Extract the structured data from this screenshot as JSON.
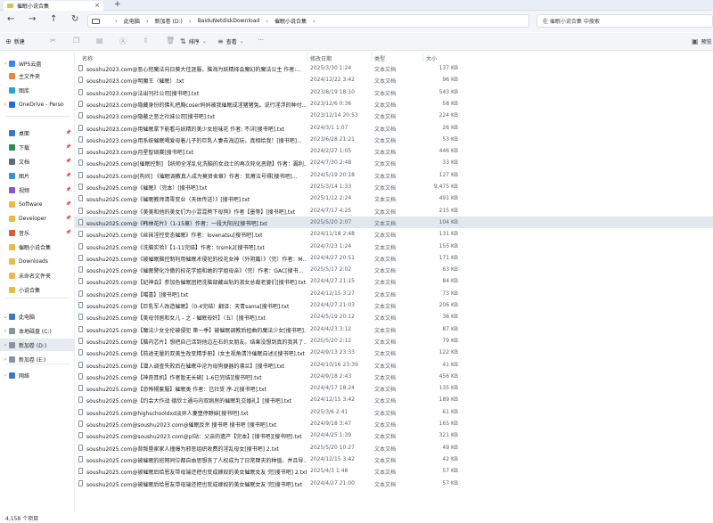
{
  "window": {
    "tab_title": "催眠小说合集",
    "tab_close": "×",
    "tab_add": "+"
  },
  "nav": {
    "back_icon": "←",
    "forward_icon": "→",
    "up_icon": "↑",
    "refresh_icon": "↻",
    "breadcrumbs": [
      "此电脑",
      "新加卷 (D:)",
      "BaiduNetdiskDownload",
      "催眠小说合集"
    ],
    "search_placeholder": "在 催眠小说合集 中搜索"
  },
  "toolbar": {
    "new_label": "新建",
    "sort_label": "排序",
    "view_label": "查看",
    "more_label": "···",
    "preview_label": "预览"
  },
  "sidebar": {
    "items": [
      {
        "label": "WPS云盘",
        "chev": "›",
        "color": "#3b82f6"
      },
      {
        "label": "主文件夹",
        "chev": "",
        "color": "#e08b3a"
      },
      {
        "label": "图库",
        "chev": "",
        "color": "#2aa0d8"
      },
      {
        "label": "OneDrive - Perso",
        "chev": "›",
        "color": "#1e6fd9"
      },
      {
        "label": "桌面",
        "chev": "",
        "color": "#3a78c8",
        "pin": true
      },
      {
        "label": "下载",
        "chev": "",
        "color": "#2b8a4e",
        "pin": true
      },
      {
        "label": "文档",
        "chev": "",
        "color": "#5b6b7e",
        "pin": true
      },
      {
        "label": "图片",
        "chev": "",
        "color": "#3a8fd8",
        "pin": true
      },
      {
        "label": "视频",
        "chev": "",
        "color": "#8b54c9",
        "pin": true
      },
      {
        "label": "Software",
        "chev": "",
        "color": "#e9b949",
        "pin": true
      },
      {
        "label": "Developer",
        "chev": "",
        "color": "#e9b949",
        "pin": true
      },
      {
        "label": "音乐",
        "chev": "",
        "color": "#e05a3a",
        "pin": true
      },
      {
        "label": "催眠小说合集",
        "chev": "",
        "color": "#e9b949"
      },
      {
        "label": "Downloads",
        "chev": "",
        "color": "#e9b949"
      },
      {
        "label": "未命名文件夹",
        "chev": "",
        "color": "#e9b949"
      },
      {
        "label": "小说合集",
        "chev": "",
        "color": "#e9b949"
      },
      {
        "label": "此电脑",
        "chev": "⌄",
        "color": "#3a78c8"
      },
      {
        "label": "本地磁盘 (C:)",
        "chev": "›",
        "color": "#8a93a0"
      },
      {
        "label": "新加卷 (D:)",
        "chev": "›",
        "color": "#8a93a0",
        "selected": true
      },
      {
        "label": "新加卷 (E:)",
        "chev": "›",
        "color": "#8a93a0"
      },
      {
        "label": "网络",
        "chev": "›",
        "color": "#3a78c8"
      }
    ]
  },
  "list": {
    "columns": {
      "name": "名称",
      "date": "修改日期",
      "type": "类型",
      "size": "大小"
    },
    "rows": [
      {
        "name": "soushu2023.com@恶心挖魔法向日葵大佳涯服，脑海为妖精择会魔幻的魔法公主 作者:...",
        "date": "2025/3/30 1:24",
        "type": "文本文档",
        "size": "137 KB"
      },
      {
        "name": "soushu2023.com@明魔王（催眠）.txt",
        "date": "2024/12/22 3:42",
        "type": "文本文档",
        "size": "96 KB"
      },
      {
        "name": "soushu2023.com@法出刊社公司[搜书吧].txt",
        "date": "2023/8/19 18:10",
        "type": "文本文档",
        "size": "543 KB"
      },
      {
        "name": "soushu2023.com@隐藏身份的佛礼把胸coser妈妈被我催眠成淫猪猪兔。说行淫浮的种付...",
        "date": "2023/12/6 0:36",
        "type": "文本文档",
        "size": "58 KB"
      },
      {
        "name": "soushu2023.com@隐蔽之恶之社妹公司[搜书吧].txt",
        "date": "2023/12/14 20:53",
        "type": "文本文档",
        "size": "224 KB"
      },
      {
        "name": "soushu2023.com@用催眠拿下能看与妖精的美少女班味花 作者: 不详[搜书吧].txt",
        "date": "2024/3/1 1:07",
        "type": "文本文档",
        "size": "26 KB"
      },
      {
        "name": "soushu2023.com@用系统催眠喝爱母着儿子的巨乳人妻去海边玩，真相给我！[搜书吧]...",
        "date": "2023/6/28 21:21",
        "type": "文本文档",
        "size": "53 KB"
      },
      {
        "name": "soushu2023.com@月星智硕赛[搜书吧].txt",
        "date": "2024/2/27 1:05",
        "type": "文本文档",
        "size": "446 KB"
      },
      {
        "name": "soushu2025.com@[催眠控制] 【统帅全淫乱化洗脑的女战士的再次轮化恶题】作者：霸利...",
        "date": "2024/7/30 2:48",
        "type": "文本文档",
        "size": "33 KB"
      },
      {
        "name": "soushu2025.com@[构间] 《催眠调教真人成为莫贤舍章》作者：贫瘠法号得[搜书吧]...",
        "date": "2024/5/19 20:18",
        "type": "文本文档",
        "size": "127 KB"
      },
      {
        "name": "soushu2025.com@《催眠》（完本）[搜书吧].txt",
        "date": "2025/3/14 1:33",
        "type": "文本文档",
        "size": "9,475 KB"
      },
      {
        "name": "soushu2025.com@《催眠教师清零变业（天体传送）》[搜书吧].txt",
        "date": "2025/1/12 2:24",
        "type": "文本文档",
        "size": "491 KB"
      },
      {
        "name": "soushu2025.com@《美美和他的美女们为小混混胯下母狗》作者【墨等】[搜书吧].txt",
        "date": "2024/7/17 4:25",
        "type": "文本文档",
        "size": "215 KB"
      },
      {
        "name": "soushu2025.com@《韩林花片》（1-15章）作者：一段大阳光[搜书吧].txt",
        "date": "2025/5/20 2:07",
        "type": "文本文档",
        "size": "104 KB",
        "selected": true
      },
      {
        "name": "soushu2025.com@《丝袜淫控变态催眠》作者：lovenatsu[搜书吧].txt",
        "date": "2024/11/18 2:48",
        "type": "文本文档",
        "size": "131 KB"
      },
      {
        "name": "soushu2025.com@《洗脑实验》【1-11完结】作者：trsmk2[搜书吧].txt",
        "date": "2024/7/23 1:24",
        "type": "文本文档",
        "size": "155 KB"
      },
      {
        "name": "soushu2025.com@《被催眠脑控制利用催眠术侵犯的校花女神（外阴篇）》（完）作者：M...",
        "date": "2024/4/27 20:51",
        "type": "文本文档",
        "size": "171 KB"
      },
      {
        "name": "soushu2025.com@《催眠警化冷傲的校花学姐和她的学姐母亲》（完）作者：GAC[搜书...",
        "date": "2025/5/17 2:02",
        "type": "文本文档",
        "size": "63 KB"
      },
      {
        "name": "soushu2025.com@【妃神会】参加色催眠团把洗脑部藏出轨的淑女总裁老婆们[搜书吧].txt",
        "date": "2024/4/27 21:15",
        "type": "文本文档",
        "size": "84 KB"
      },
      {
        "name": "soushu2025.com@【噶喜】[搜书吧].txt",
        "date": "2024/12/15 3:27",
        "type": "文本文档",
        "size": "73 KB"
      },
      {
        "name": "soushu2025.com@【巨乳军人改造催眠】（0-4完结）翻译：天青sama[搜书吧].txt",
        "date": "2024/4/27 21:03",
        "type": "文本文档",
        "size": "206 KB"
      },
      {
        "name": "soushu2025.com@【美母邻居和女儿 - 之 - 催眠母奸】（五）[搜书吧].txt",
        "date": "2024/5/19 20:12",
        "type": "文本文档",
        "size": "38 KB"
      },
      {
        "name": "soushu2025.com@【魔法少女全伦被侵犯 第一季】被催眠调教后扭曲的魔法少女[搜书吧]...",
        "date": "2024/4/23 3:12",
        "type": "文本文档",
        "size": "87 KB"
      },
      {
        "name": "soushu2025.com@【脑内芯片】想把自己活到他边左右的女朋友。结果没想到真的我其了...",
        "date": "2025/5/20 2:12",
        "type": "文本文档",
        "size": "79 KB"
      },
      {
        "name": "soushu2025.com@【前途无量的双美生改变精手册】(女主视角清冷催眠自述)[搜书吧].txt",
        "date": "2024/9/13 23:33",
        "type": "文本文档",
        "size": "122 KB"
      },
      {
        "name": "soushu2025.com@【潜入调查失败后在催眠中沦为母狗便器的凛兰】[搜书吧].txt",
        "date": "2024/10/16 23:39",
        "type": "文本文档",
        "size": "41 KB"
      },
      {
        "name": "soushu2025.com@【神奇耳机】作者暂无长碗[ 1-6已完结][搜书吧].txt",
        "date": "2024/9/18 2:43",
        "type": "文本文档",
        "size": "456 KB"
      },
      {
        "name": "soushu2025.com@【恐怖幌套服】催眠类 作者：已社受 序-2[搜书吧].txt",
        "date": "2024/4/17 18:24",
        "type": "文本文档",
        "size": "135 KB"
      },
      {
        "name": "soushu2025.com@【约会大作战 德欣士通与内双病房的催眠乳交婚礼】[搜书吧].txt",
        "date": "2024/12/15 3:42",
        "type": "文本文档",
        "size": "189 KB"
      },
      {
        "name": "soushu2025.com@highschooldxd淡异人妻堕停野妹[搜书吧].txt",
        "date": "2025/3/6 2:41",
        "type": "文本文档",
        "size": "61 KB"
      },
      {
        "name": "soushu2025.com@soushu2023.com@催眠反杀 搜书吧 搜书吧 [搜书吧].txt",
        "date": "2024/9/18 3:47",
        "type": "文本文档",
        "size": "165 KB"
      },
      {
        "name": "soushu2025.com@soushu2023.com@pl站：父亲的遗产【完本】[搜书吧][搜书吧].txt",
        "date": "2024/4/25 1:39",
        "type": "文本文档",
        "size": "321 KB"
      },
      {
        "name": "soushu2025.com@背叛暨家家人撞爆为邪恶组织收费的淫乱母女[搜书吧] 2.txt",
        "date": "2025/5/20 10:27",
        "type": "文本文档",
        "size": "49 KB"
      },
      {
        "name": "soushu2025.com@被催眠的班网同位都自由思想丧了人权成为了日常肆夫的种值、并且导...",
        "date": "2024/12/15 3:42",
        "type": "文本文档",
        "size": "42 KB"
      },
      {
        "name": "soushu2025.com@被催眠后给恩友带母端还把也变成嫁奴的美女催眠女友 完[搜书吧] 2.txt",
        "date": "2025/4/3 1:48",
        "type": "文本文档",
        "size": "57 KB"
      },
      {
        "name": "soushu2025.com@被催眠后给恩友带母端还把也变成嫁奴的美女催眠女友 完[搜书吧].txt",
        "date": "2024/4/27 21:00",
        "type": "文本文档",
        "size": "57 KB"
      }
    ]
  },
  "status": {
    "item_count": "4,158 个项目"
  }
}
